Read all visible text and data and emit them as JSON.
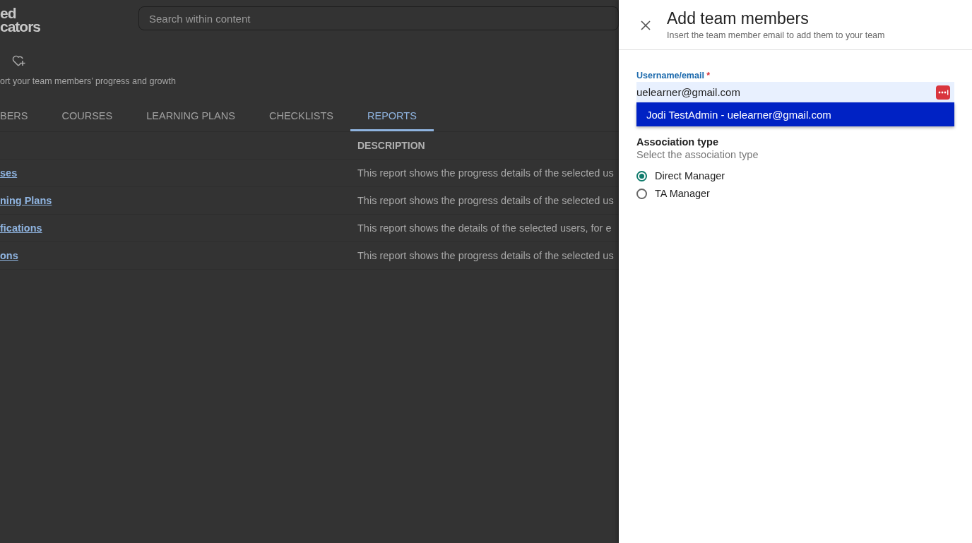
{
  "background_page": {
    "logo": [
      "ed",
      "cators"
    ],
    "search": {
      "placeholder": "Search within content"
    },
    "subtitle": "ort your team members’ progress and growth",
    "tabs": [
      {
        "label": "BERS",
        "selected": false
      },
      {
        "label": "COURSES",
        "selected": false
      },
      {
        "label": "LEARNING PLANS",
        "selected": false
      },
      {
        "label": "CHECKLISTS",
        "selected": false
      },
      {
        "label": "REPORTS",
        "selected": true
      }
    ],
    "table": {
      "description_heading": "DESCRIPTION",
      "rows": [
        {
          "name": "ses",
          "description": "This report shows the progress details of the selected us"
        },
        {
          "name": "ning Plans",
          "description": "This report shows the progress details of the selected us"
        },
        {
          "name": "fications",
          "description": "This report shows the details of the selected users, for e"
        },
        {
          "name": "ons",
          "description": "This report shows the progress details of the selected us"
        }
      ]
    }
  },
  "panel": {
    "title": "Add team members",
    "subtitle": "Insert the team member email to add them to your team",
    "field": {
      "label": "Username/email",
      "required": "*",
      "value": "uelearner@gmail.com"
    },
    "suggestions": [
      {
        "text": "Jodi TestAdmin - uelearner@gmail.com",
        "selected": true
      }
    ],
    "association": {
      "title": "Association type",
      "hint": "Select the association type",
      "options": [
        {
          "label": "Direct Manager",
          "selected": true
        },
        {
          "label": "TA Manager",
          "selected": false
        }
      ]
    }
  }
}
